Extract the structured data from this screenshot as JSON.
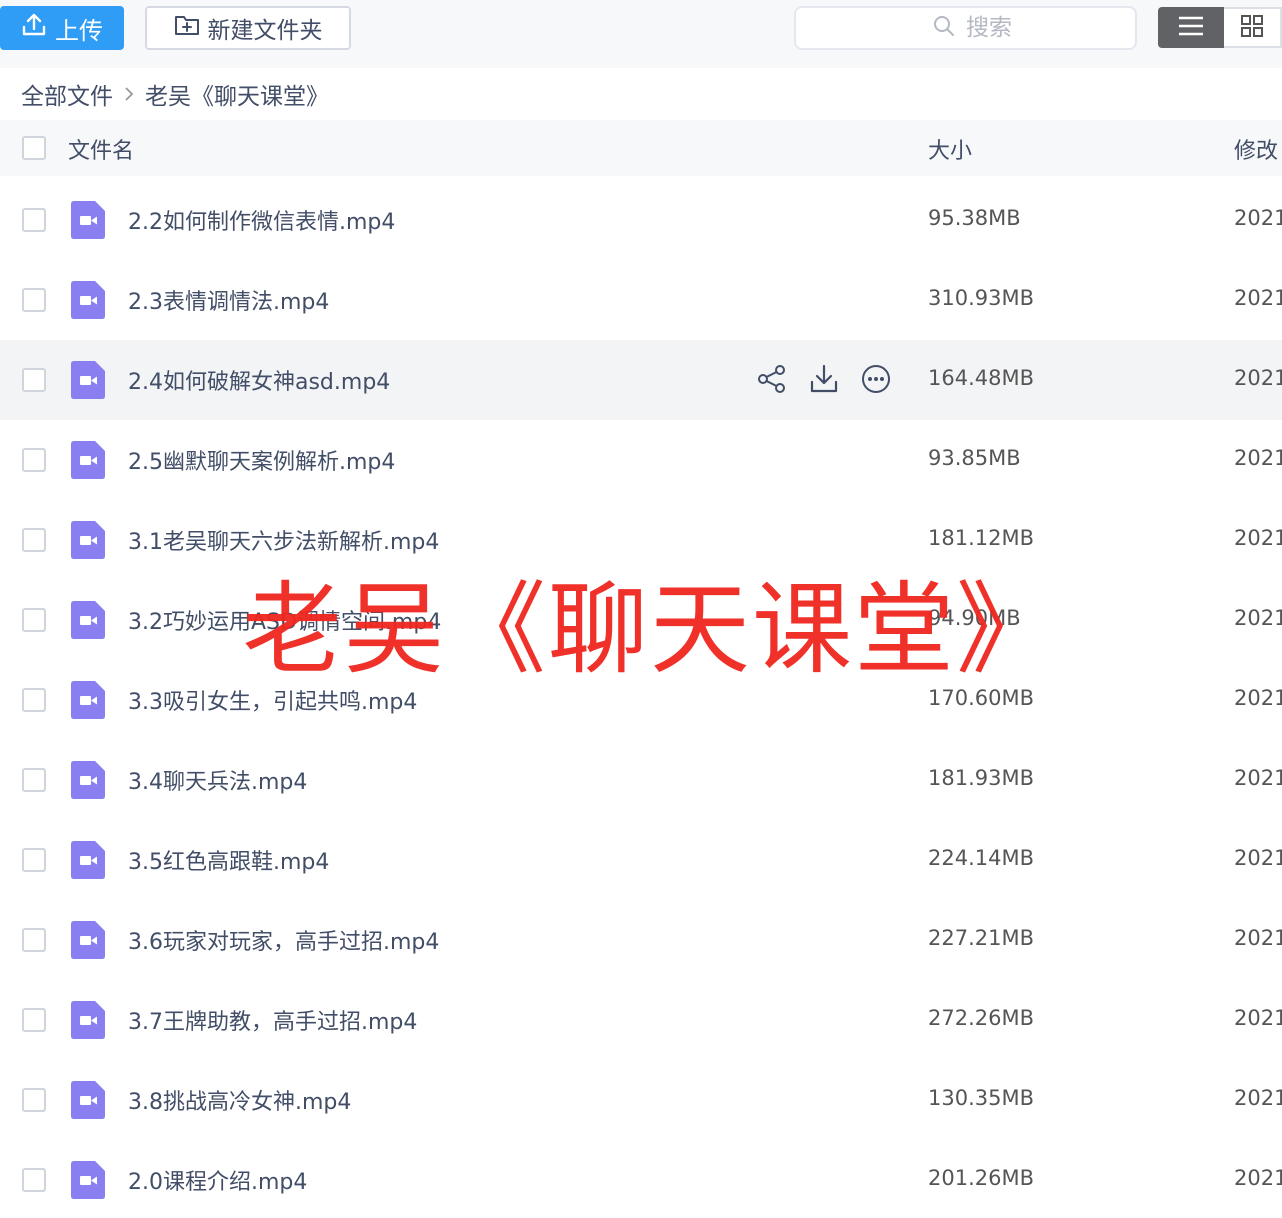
{
  "toolbar": {
    "upload_label": "上传",
    "new_folder_label": "新建文件夹",
    "search_placeholder": "搜索",
    "upload_color": "#2f9cf6"
  },
  "breadcrumb": {
    "root": "全部文件",
    "current": "老吴《聊天课堂》"
  },
  "columns": {
    "name": "文件名",
    "size": "大小",
    "modified": "修改"
  },
  "files": [
    {
      "name": "2.2如何制作微信表情.mp4",
      "size": "95.38MB",
      "modified": "2021"
    },
    {
      "name": "2.3表情调情法.mp4",
      "size": "310.93MB",
      "modified": "2021"
    },
    {
      "name": "2.4如何破解女神asd.mp4",
      "size": "164.48MB",
      "modified": "2021"
    },
    {
      "name": "2.5幽默聊天案例解析.mp4",
      "size": "93.85MB",
      "modified": "2021"
    },
    {
      "name": "3.1老吴聊天六步法新解析.mp4",
      "size": "181.12MB",
      "modified": "2021"
    },
    {
      "name": "3.2巧妙运用ASD调情空间.mp4",
      "size": "94.90MB",
      "modified": "2021"
    },
    {
      "name": "3.3吸引女生，引起共鸣.mp4",
      "size": "170.60MB",
      "modified": "2021"
    },
    {
      "name": "3.4聊天兵法.mp4",
      "size": "181.93MB",
      "modified": "2021"
    },
    {
      "name": "3.5红色高跟鞋.mp4",
      "size": "224.14MB",
      "modified": "2021"
    },
    {
      "name": "3.6玩家对玩家，高手过招.mp4",
      "size": "227.21MB",
      "modified": "2021"
    },
    {
      "name": "3.7王牌助教，高手过招.mp4",
      "size": "272.26MB",
      "modified": "2021"
    },
    {
      "name": "3.8挑战高冷女神.mp4",
      "size": "130.35MB",
      "modified": "2021"
    },
    {
      "name": "2.0课程介绍.mp4",
      "size": "201.26MB",
      "modified": "2021"
    }
  ],
  "hovered_row": 2,
  "watermark": "老吴《聊天课堂》",
  "colors": {
    "video_icon": "#8a7ff0",
    "watermark": "#f0261f"
  },
  "icons": [
    "upload-icon",
    "new-folder-icon",
    "search-icon",
    "list-view-icon",
    "grid-view-icon",
    "video-file-icon",
    "share-icon",
    "download-icon",
    "more-icon",
    "chevron-right-icon"
  ]
}
